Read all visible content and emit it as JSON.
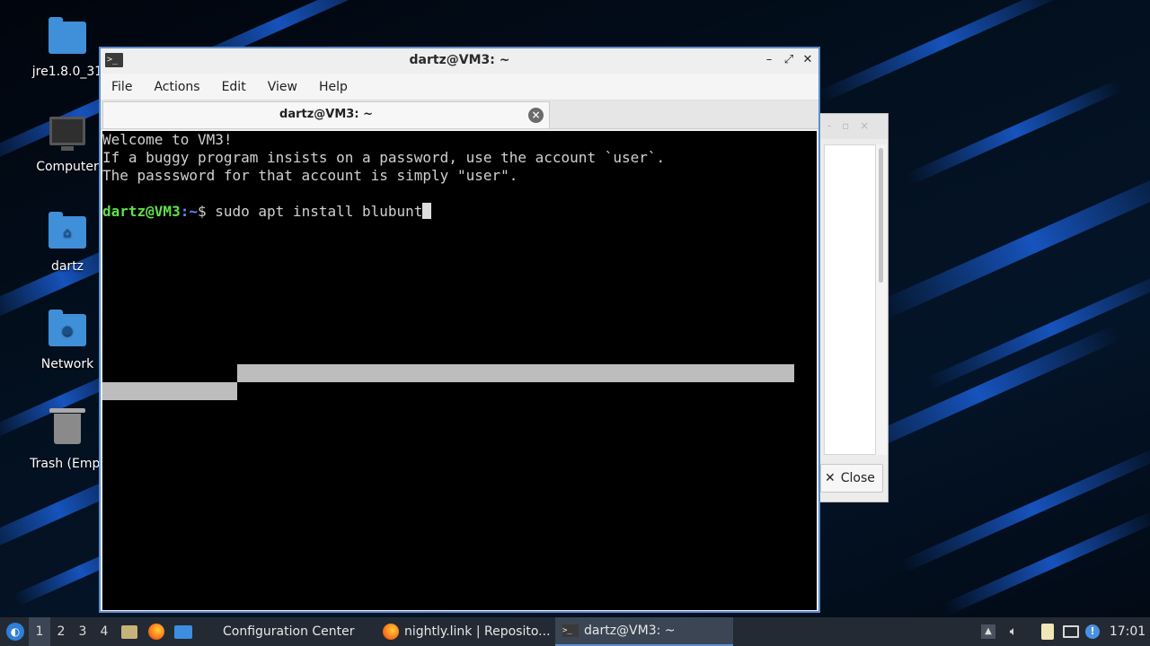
{
  "desktop": {
    "icons": [
      {
        "label": "jre1.8.0_31",
        "icon": "folder-icon"
      },
      {
        "label": "Computer",
        "icon": "computer-icon"
      },
      {
        "label": "dartz",
        "icon": "home-folder-icon"
      },
      {
        "label": "Network",
        "icon": "network-folder-icon"
      },
      {
        "label": "Trash (Empt",
        "icon": "trash-icon"
      }
    ]
  },
  "background_dialog": {
    "close_label": "Close"
  },
  "terminal": {
    "title": "dartz@VM3: ~",
    "menu": [
      "File",
      "Actions",
      "Edit",
      "View",
      "Help"
    ],
    "tab_label": "dartz@VM3: ~",
    "output": [
      "Welcome to VM3!",
      "If a buggy program insists on a password, use the account `user`.",
      "The passsword for that account is simply \"user\"."
    ],
    "prompt": {
      "user_host": "dartz@VM3",
      "path": ":~",
      "symbol": "$ ",
      "command": "sudo apt install blubunt"
    }
  },
  "taskbar": {
    "workspaces": [
      "1",
      "2",
      "3",
      "4"
    ],
    "active_workspace": "1",
    "tasks": [
      {
        "label": "Configuration Center",
        "icon": "settings-icon"
      },
      {
        "label": "nightly.link | Reposito...",
        "icon": "firefox-icon"
      },
      {
        "label": "dartz@VM3: ~",
        "icon": "terminal-icon"
      }
    ],
    "clock": "17:01"
  },
  "colors": {
    "window_border": "#5c8ed0",
    "prompt_user": "#5fe04a",
    "prompt_path": "#5b8fff",
    "taskbar": "#232a33"
  }
}
